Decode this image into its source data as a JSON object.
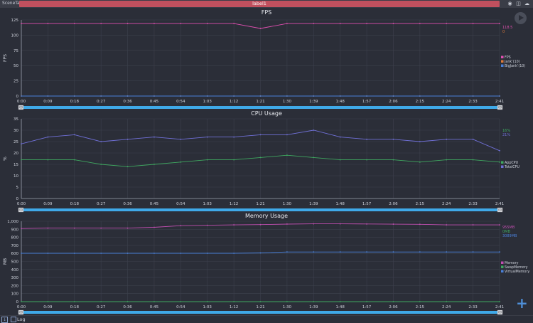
{
  "topbar": {
    "scene_tab": "SceneTab",
    "label": "label1",
    "icons": [
      "location-icon",
      "folder-icon",
      "cloud-icon"
    ]
  },
  "time_ticks": [
    "0:00",
    "0:09",
    "0:18",
    "0:27",
    "0:36",
    "0:45",
    "0:54",
    "1:03",
    "1:12",
    "1:21",
    "1:30",
    "1:39",
    "1:48",
    "1:57",
    "2:06",
    "2:15",
    "2:24",
    "2:33",
    "2:41"
  ],
  "slider": {
    "left_handle": "00",
    "right_handle": "00"
  },
  "bottombar": {
    "log_label": "Log"
  },
  "chart_data": [
    {
      "type": "line",
      "title": "FPS",
      "ylabel": "FPS",
      "ylim": [
        0,
        125
      ],
      "yticks": [
        0,
        25,
        50,
        75,
        100,
        125
      ],
      "x": [
        "0:00",
        "0:09",
        "0:18",
        "0:27",
        "0:36",
        "0:45",
        "0:54",
        "1:03",
        "1:12",
        "1:21",
        "1:30",
        "1:39",
        "1:48",
        "1:57",
        "2:06",
        "2:15",
        "2:24",
        "2:33",
        "2:41"
      ],
      "series": [
        {
          "name": "FPS",
          "color": "#e04fb0",
          "values": [
            119,
            119,
            119,
            119,
            119,
            119,
            119,
            119,
            119,
            111,
            119,
            119,
            119,
            119,
            119,
            119,
            119,
            119,
            119
          ]
        },
        {
          "name": "Jank’(10)",
          "color": "#e07b3a",
          "values": [
            0,
            0,
            0,
            0,
            0,
            0,
            0,
            0,
            0,
            0,
            0,
            0,
            0,
            0,
            0,
            0,
            0,
            0,
            0
          ]
        },
        {
          "name": "BigJank’(10)",
          "color": "#4a80d8",
          "values": [
            0,
            0,
            0,
            0,
            0,
            0,
            0,
            0,
            0,
            0,
            0,
            0,
            0,
            0,
            0,
            0,
            0,
            0,
            0
          ]
        }
      ],
      "side_values": [
        {
          "text": "118.5",
          "color": "#e04fb0"
        },
        {
          "text": "0",
          "color": "#e07b3a"
        }
      ]
    },
    {
      "type": "line",
      "title": "CPU Usage",
      "ylabel": "%",
      "ylim": [
        0,
        35
      ],
      "yticks": [
        0,
        5,
        10,
        15,
        20,
        25,
        30,
        35
      ],
      "x": [
        "0:00",
        "0:09",
        "0:18",
        "0:27",
        "0:36",
        "0:45",
        "0:54",
        "1:03",
        "1:12",
        "1:21",
        "1:30",
        "1:39",
        "1:48",
        "1:57",
        "2:06",
        "2:15",
        "2:24",
        "2:33",
        "2:41"
      ],
      "series": [
        {
          "name": "AppCPU",
          "color": "#3fa860",
          "values": [
            17,
            17,
            17,
            15,
            14,
            15,
            16,
            17,
            17,
            18,
            19,
            18,
            17,
            17,
            17,
            16,
            17,
            17,
            16
          ]
        },
        {
          "name": "TotalCPU",
          "color": "#7070d8",
          "values": [
            24,
            27,
            28,
            25,
            26,
            27,
            26,
            27,
            27,
            28,
            28,
            30,
            27,
            26,
            26,
            25,
            26,
            26,
            21
          ]
        }
      ],
      "side_values": [
        {
          "text": "16%",
          "color": "#3fa860"
        },
        {
          "text": "21%",
          "color": "#7070d8"
        }
      ]
    },
    {
      "type": "line",
      "title": "Memory Usage",
      "ylabel": "MB",
      "ylim": [
        0,
        1000
      ],
      "yticks": [
        0,
        100,
        200,
        300,
        400,
        500,
        600,
        700,
        800,
        900,
        1000
      ],
      "x": [
        "0:00",
        "0:09",
        "0:18",
        "0:27",
        "0:36",
        "0:45",
        "0:54",
        "1:03",
        "1:12",
        "1:21",
        "1:30",
        "1:39",
        "1:48",
        "1:57",
        "2:06",
        "2:15",
        "2:24",
        "2:33",
        "2:41"
      ],
      "series": [
        {
          "name": "Memory",
          "color": "#c04fb0",
          "values": [
            910,
            915,
            915,
            915,
            915,
            925,
            945,
            950,
            955,
            958,
            965,
            968,
            968,
            966,
            964,
            962,
            955,
            955,
            955
          ]
        },
        {
          "name": "SwapMemory",
          "color": "#3fa860",
          "values": [
            0,
            0,
            0,
            0,
            0,
            0,
            0,
            0,
            0,
            0,
            0,
            0,
            0,
            0,
            0,
            0,
            0,
            0,
            0
          ]
        },
        {
          "name": "VirtualMemory",
          "color": "#4a80d8",
          "values": [
            602,
            602,
            602,
            602,
            602,
            602,
            602,
            602,
            602,
            606,
            618,
            618,
            618,
            618,
            618,
            618,
            618,
            618,
            618
          ]
        }
      ],
      "side_values": [
        {
          "text": "955MB",
          "color": "#c04fb0"
        },
        {
          "text": "0MB",
          "color": "#3fa860"
        },
        {
          "text": "3089MB",
          "color": "#4a80d8"
        }
      ]
    }
  ]
}
